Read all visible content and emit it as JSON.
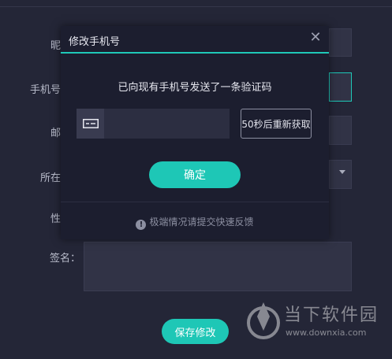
{
  "form": {
    "nickname_label": "昵",
    "phone_label": "手机号",
    "email_label": "邮",
    "location_label": "所在",
    "gender_label": "性",
    "signature_label": "签名：",
    "save_label": "保存修改"
  },
  "dialog": {
    "title": "修改手机号",
    "close_glyph": "✕",
    "message": "已向现有手机号发送了一条验证码",
    "code_placeholder": "",
    "resend_label": "50秒后重新获取",
    "confirm_label": "确定",
    "feedback_glyph": "!",
    "feedback_text": "极端情况请提交快速反馈"
  },
  "watermark": {
    "name": "当下软件园",
    "url": "www.downxia.com"
  },
  "colors": {
    "accent": "#1ec7b6",
    "background": "#242637",
    "dialog": "#1c1e2f"
  }
}
